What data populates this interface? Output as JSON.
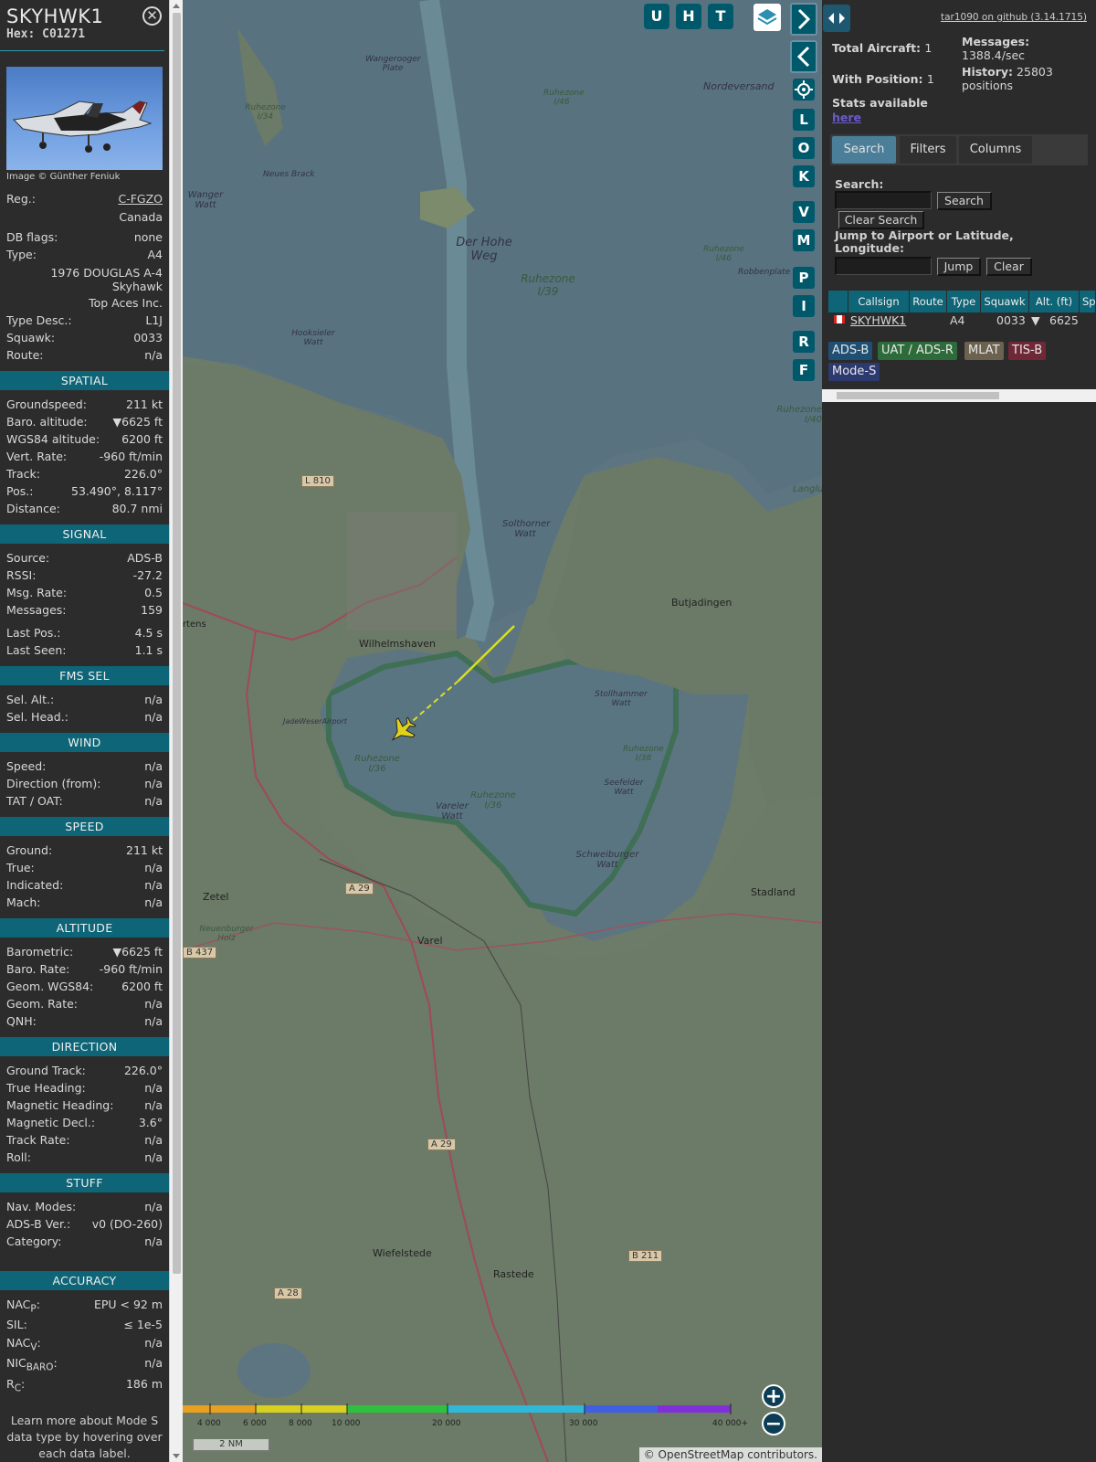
{
  "aircraft": {
    "callsign": "SKYHWK1",
    "hex_label": "Hex:",
    "hex": "C01271",
    "photo_credit": "Image © Günther Feniuk"
  },
  "details": [
    {
      "label": "Reg.:",
      "value": "C-FGZO",
      "link": true
    },
    {
      "label": "",
      "value": "Canada"
    },
    {
      "label": "DB flags:",
      "value": "none"
    },
    {
      "label": "Type:",
      "value": "A4"
    },
    {
      "label": "",
      "value": "1976 DOUGLAS A-4"
    },
    {
      "label": "",
      "value": "Skyhawk"
    },
    {
      "label": "",
      "value": "Top Aces Inc."
    },
    {
      "label": "Type Desc.:",
      "value": "L1J"
    },
    {
      "label": "Squawk:",
      "value": "0033"
    },
    {
      "label": "Route:",
      "value": "n/a"
    }
  ],
  "sections": {
    "spatial": {
      "title": "SPATIAL",
      "rows": [
        {
          "label": "Groundspeed:",
          "value": "211 kt"
        },
        {
          "label": "Baro. altitude:",
          "value": "▼6625 ft"
        },
        {
          "label": "WGS84 altitude:",
          "value": "6200 ft"
        },
        {
          "label": "Vert. Rate:",
          "value": "-960 ft/min"
        },
        {
          "label": "Track:",
          "value": "226.0°"
        },
        {
          "label": "Pos.:",
          "value": "53.490°, 8.117°"
        },
        {
          "label": "Distance:",
          "value": "80.7 nmi"
        }
      ]
    },
    "signal": {
      "title": "SIGNAL",
      "rows": [
        {
          "label": "Source:",
          "value": "ADS-B"
        },
        {
          "label": "RSSI:",
          "value": "-27.2"
        },
        {
          "label": "Msg. Rate:",
          "value": "0.5"
        },
        {
          "label": "Messages:",
          "value": "159"
        },
        {
          "label": "Last Pos.:",
          "value": "4.5 s"
        },
        {
          "label": "Last Seen:",
          "value": "1.1 s"
        }
      ]
    },
    "fms": {
      "title": "FMS SEL",
      "rows": [
        {
          "label": "Sel. Alt.:",
          "value": "n/a"
        },
        {
          "label": "Sel. Head.:",
          "value": "n/a"
        }
      ]
    },
    "wind": {
      "title": "WIND",
      "rows": [
        {
          "label": "Speed:",
          "value": "n/a"
        },
        {
          "label": "Direction (from):",
          "value": "n/a"
        },
        {
          "label": "TAT / OAT:",
          "value": "n/a"
        }
      ]
    },
    "speed": {
      "title": "SPEED",
      "rows": [
        {
          "label": "Ground:",
          "value": "211 kt"
        },
        {
          "label": "True:",
          "value": "n/a"
        },
        {
          "label": "Indicated:",
          "value": "n/a"
        },
        {
          "label": "Mach:",
          "value": "n/a"
        }
      ]
    },
    "altitude": {
      "title": "ALTITUDE",
      "rows": [
        {
          "label": "Barometric:",
          "value": "▼6625 ft"
        },
        {
          "label": "Baro. Rate:",
          "value": "-960 ft/min"
        },
        {
          "label": "Geom. WGS84:",
          "value": "6200 ft"
        },
        {
          "label": "Geom. Rate:",
          "value": "n/a"
        },
        {
          "label": "QNH:",
          "value": "n/a"
        }
      ]
    },
    "direction": {
      "title": "DIRECTION",
      "rows": [
        {
          "label": "Ground Track:",
          "value": "226.0°"
        },
        {
          "label": "True Heading:",
          "value": "n/a"
        },
        {
          "label": "Magnetic Heading:",
          "value": "n/a"
        },
        {
          "label": "Magnetic Decl.:",
          "value": "3.6°"
        },
        {
          "label": "Track Rate:",
          "value": "n/a"
        },
        {
          "label": "Roll:",
          "value": "n/a"
        }
      ]
    },
    "stuff": {
      "title": "STUFF",
      "rows": [
        {
          "label": "Nav. Modes:",
          "value": "n/a"
        },
        {
          "label": "ADS-B Ver.:",
          "value": "v0 (DO-260)"
        },
        {
          "label": "Category:",
          "value": "n/a"
        }
      ]
    },
    "accuracy": {
      "title": "ACCURACY",
      "rows": [
        {
          "label": "NAC",
          "sub": "P",
          "suffix": ":",
          "value": "EPU < 92 m"
        },
        {
          "label": "SIL:",
          "sub": "",
          "suffix": "",
          "value": "≤ 1e-5"
        },
        {
          "label": "NAC",
          "sub": "V",
          "suffix": ":",
          "value": "n/a"
        },
        {
          "label": "NIC",
          "sub": "BARO",
          "suffix": ":",
          "value": "n/a"
        },
        {
          "label": "R",
          "sub": "C",
          "suffix": ":",
          "value": "186 m"
        }
      ]
    }
  },
  "learn_more": "Learn more about Mode S data type by hovering over each data label.",
  "map": {
    "buttons": [
      "U",
      "H",
      "T",
      "L",
      "O",
      "K",
      "V",
      "M",
      "P",
      "I",
      "R",
      "F"
    ],
    "places": [
      {
        "name": "Wangerooger Plate"
      },
      {
        "name": "Nordeversand"
      },
      {
        "name": "Ruhezone I/46"
      },
      {
        "name": "Ruhezone I/34"
      },
      {
        "name": "Neues Brack"
      },
      {
        "name": "Wanger Watt"
      },
      {
        "name": "Der Hohe Weg"
      },
      {
        "name": "Ruhezone I/39"
      },
      {
        "name": "Ruhezone I/46"
      },
      {
        "name": "Robbenplate"
      },
      {
        "name": "Hooksieler Watt"
      },
      {
        "name": "Ruhezone I/40"
      },
      {
        "name": "L 810"
      },
      {
        "name": "Solthorner Watt"
      },
      {
        "name": "Langlu"
      },
      {
        "name": "Butjadingen"
      },
      {
        "name": "rtens"
      },
      {
        "name": "Wilhelmshaven"
      },
      {
        "name": "JadeWeserAirport"
      },
      {
        "name": "Stollhammer Watt"
      },
      {
        "name": "Ruhezone I/36"
      },
      {
        "name": "Ruhezone I/38"
      },
      {
        "name": "Seefelder Watt"
      },
      {
        "name": "Ruhezone I/36"
      },
      {
        "name": "Vareler Watt"
      },
      {
        "name": "Schweiburger Watt"
      },
      {
        "name": "Stadland"
      },
      {
        "name": "A 29"
      },
      {
        "name": "Zetel"
      },
      {
        "name": "Neuenburger Holz"
      },
      {
        "name": "B 437"
      },
      {
        "name": "Varel"
      },
      {
        "name": "A 29"
      },
      {
        "name": "B 211"
      },
      {
        "name": "Wiefelstede"
      },
      {
        "name": "Rastede"
      },
      {
        "name": "A 28"
      }
    ],
    "altitude_scale": [
      "4 000",
      "6 000",
      "8 000",
      "10 000",
      "20 000",
      "30 000",
      "40 000+"
    ],
    "scale_label": "2 NM",
    "attribution_prefix": "© ",
    "attribution_link": "OpenStreetMap",
    "attribution_suffix": " contributors."
  },
  "right": {
    "github": "tar1090 on github (3.14.1715)",
    "total_aircraft_label": "Total Aircraft:",
    "total_aircraft": "1",
    "with_position_label": "With Position:",
    "with_position": "1",
    "stats_label": "Stats available",
    "stats_link": "here",
    "messages_label": "Messages:",
    "messages_value": "1388.4/sec",
    "history_label": "History:",
    "history_value": "25803",
    "history_unit": "positions",
    "tabs": [
      "Search",
      "Filters",
      "Columns"
    ],
    "search_label": "Search:",
    "search_button": "Search",
    "clear_search_button": "Clear Search",
    "jump_label": "Jump to Airport or Latitude, Longitude:",
    "jump_button": "Jump",
    "clear_button": "Clear",
    "table": {
      "headers": [
        "Callsign",
        "Route",
        "Type",
        "Squawk",
        "Alt. (ft)",
        "Sp"
      ],
      "row": {
        "callsign": "SKYHWK1",
        "route": "",
        "type": "A4",
        "squawk": "0033",
        "alt": "6625"
      }
    },
    "badges": [
      "ADS-B",
      "UAT / ADS-R",
      "MLAT",
      "TIS-B",
      "Mode-S"
    ]
  },
  "colors": {
    "section_header": "#0e6577",
    "water": "#5d7580",
    "land": "#6d7b69",
    "route_red": "#b04a55",
    "aircraft": "#e0d21a",
    "badge_adsb": "#1f4f73",
    "badge_uat": "#2d6b3a",
    "badge_mlat": "#6b6250",
    "badge_tisb": "#6f2836",
    "badge_modes": "#2d3a70"
  }
}
